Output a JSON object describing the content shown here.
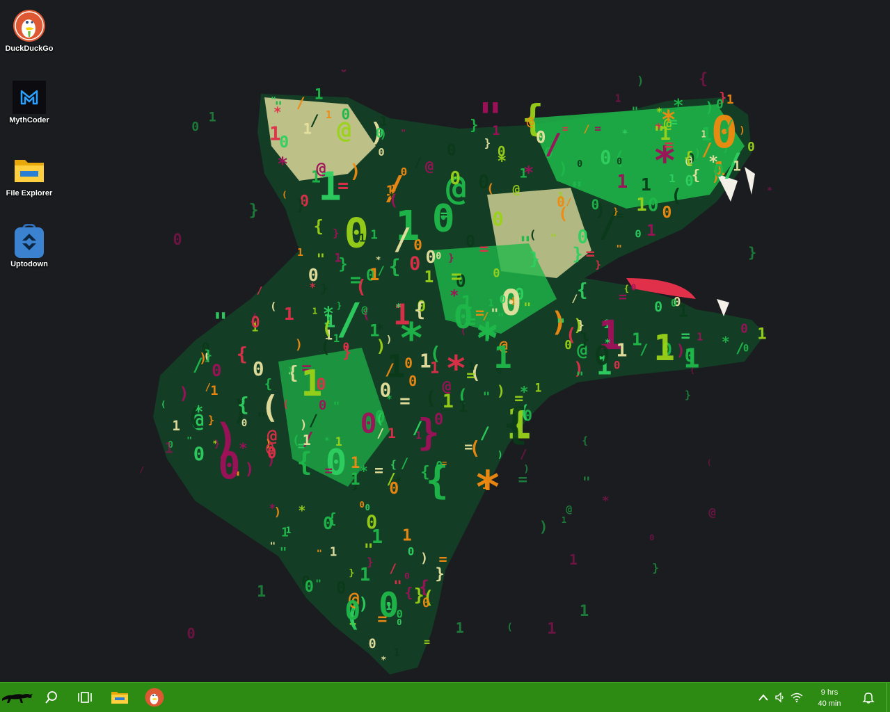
{
  "desktop": {
    "icons": [
      {
        "label": "DuckDuckGo",
        "icon": "duckduckgo-icon"
      },
      {
        "label": "MythCoder",
        "icon": "mythcoder-icon"
      },
      {
        "label": "File Explorer",
        "icon": "folder-icon"
      },
      {
        "label": "Uptodown",
        "icon": "uptodown-icon"
      }
    ],
    "wallpaper": {
      "subject": "wolf-head-made-of-code-glyphs",
      "colors": {
        "background": "#1a1c20",
        "green": "#1fb84a",
        "dark_green": "#0f5a2a",
        "lime": "#9ad21a",
        "cream": "#e8e2a0",
        "magenta": "#a0105a",
        "orange": "#f08a10",
        "red": "#e0304a"
      }
    }
  },
  "taskbar": {
    "color": "#2d8a12",
    "buttons": [
      {
        "name": "start",
        "icon": "panther-icon"
      },
      {
        "name": "search",
        "icon": "search-icon"
      },
      {
        "name": "task-view",
        "icon": "task-view-icon"
      },
      {
        "name": "file-explorer",
        "icon": "folder-icon"
      },
      {
        "name": "duckduckgo",
        "icon": "duckduckgo-icon"
      }
    ],
    "tray": {
      "icons": [
        "chevron-up-icon",
        "volume-icon",
        "wifi-icon",
        "bell-icon"
      ],
      "clock_line1": "9 hrs",
      "clock_line2": "40 min"
    }
  }
}
